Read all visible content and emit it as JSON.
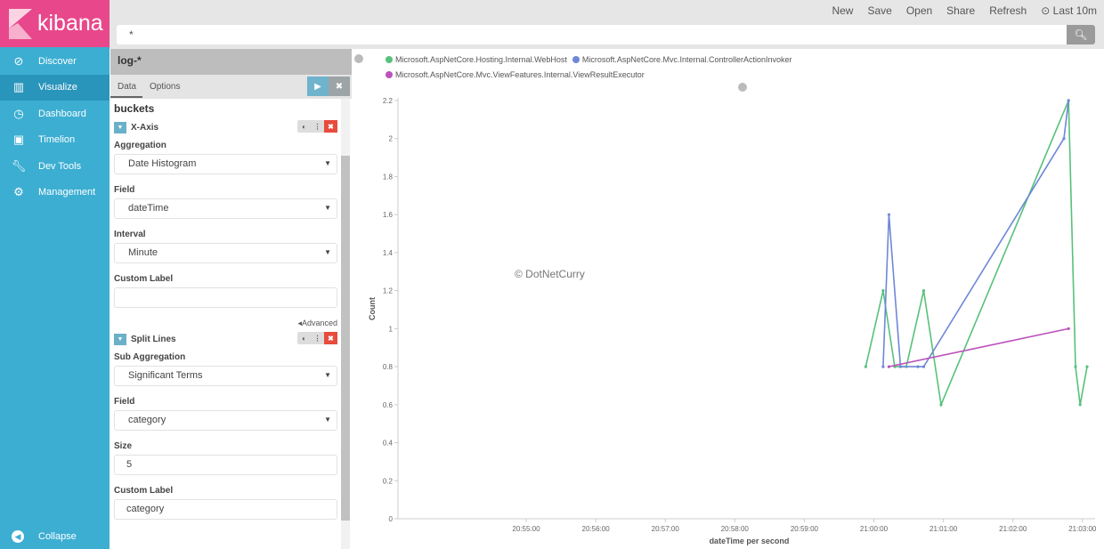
{
  "app": {
    "name": "kibana"
  },
  "sidebar": {
    "items": [
      {
        "label": "Discover",
        "icon": "compass-icon"
      },
      {
        "label": "Visualize",
        "icon": "bar-chart-icon",
        "active": true
      },
      {
        "label": "Dashboard",
        "icon": "dashboard-icon"
      },
      {
        "label": "Timelion",
        "icon": "timelion-icon"
      },
      {
        "label": "Dev Tools",
        "icon": "wrench-icon"
      },
      {
        "label": "Management",
        "icon": "gear-icon"
      }
    ],
    "collapse": "Collapse"
  },
  "topbar": {
    "menu": [
      "New",
      "Save",
      "Open",
      "Share",
      "Refresh"
    ],
    "time": "Last 10m",
    "query": "*"
  },
  "panel": {
    "index": "log-*",
    "tabs": [
      "Data",
      "Options"
    ],
    "section": "buckets",
    "xaxis": {
      "title": "X-Axis",
      "aggregation_label": "Aggregation",
      "aggregation": "Date Histogram",
      "field_label": "Field",
      "field": "dateTime",
      "interval_label": "Interval",
      "interval": "Minute",
      "custom_label_label": "Custom Label",
      "custom_label": ""
    },
    "advanced": "Advanced",
    "split": {
      "title": "Split Lines",
      "sub_label": "Sub Aggregation",
      "sub": "Significant Terms",
      "field_label": "Field",
      "field": "category",
      "size_label": "Size",
      "size": "5",
      "custom_label_label": "Custom Label",
      "custom_label": "category"
    }
  },
  "watermark": "© DotNetCurry",
  "chart_data": {
    "type": "line",
    "xlabel": "dateTime per second",
    "ylabel": "Count",
    "ylim": [
      0,
      2.2
    ],
    "yticks": [
      "0",
      "0.2",
      "0.4",
      "0.6",
      "0.8",
      "1",
      "1.2",
      "1.4",
      "1.6",
      "1.8",
      "2",
      "2.2"
    ],
    "xticks": [
      "20:55:00",
      "20:56:00",
      "20:57:00",
      "20:58:00",
      "20:59:00",
      "21:00:00",
      "21:01:00",
      "21:02:00",
      "21:03:00"
    ],
    "legend_position": "top-left",
    "series": [
      {
        "name": "Microsoft.AspNetCore.Hosting.Internal.WebHost",
        "color": "#57c17b",
        "points": [
          [
            "20:59:53",
            0.8
          ],
          [
            "21:00:08",
            1.2
          ],
          [
            "21:00:18",
            0.8
          ],
          [
            "21:00:28",
            0.8
          ],
          [
            "21:00:43",
            1.2
          ],
          [
            "21:00:58",
            0.6
          ],
          [
            "21:02:48",
            2.2
          ],
          [
            "21:02:54",
            0.8
          ],
          [
            "21:02:58",
            0.6
          ],
          [
            "21:03:04",
            0.8
          ]
        ]
      },
      {
        "name": "Microsoft.AspNetCore.Mvc.Internal.ControllerActionInvoker",
        "color": "#6f87d8",
        "points": [
          [
            "21:00:08",
            0.8
          ],
          [
            "21:00:13",
            1.6
          ],
          [
            "21:00:23",
            0.8
          ],
          [
            "21:00:38",
            0.8
          ],
          [
            "21:00:43",
            0.8
          ],
          [
            "21:02:44",
            2.0
          ],
          [
            "21:02:48",
            2.2
          ]
        ]
      },
      {
        "name": "Microsoft.AspNetCore.Mvc.ViewFeatures.Internal.ViewResultExecutor",
        "color": "#bc52bc",
        "points": [
          [
            "21:00:13",
            0.8
          ],
          [
            "21:02:48",
            1.0
          ]
        ]
      }
    ]
  }
}
